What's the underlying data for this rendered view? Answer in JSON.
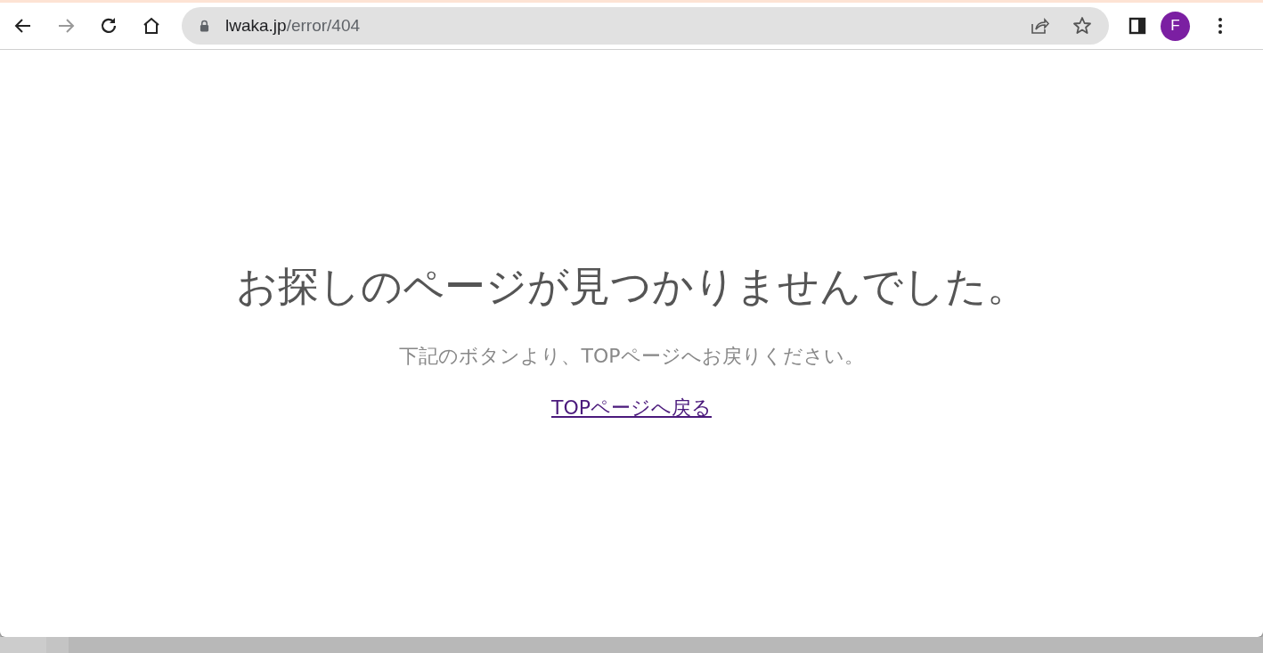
{
  "browser": {
    "url": {
      "host": "lwaka.jp",
      "path": "/error/404"
    },
    "profile_initial": "F"
  },
  "page": {
    "heading": "お探しのページが見つかりませんでした。",
    "message": "下記のボタンより、TOPページへお戻りください。",
    "link": "TOPページへ戻る"
  }
}
